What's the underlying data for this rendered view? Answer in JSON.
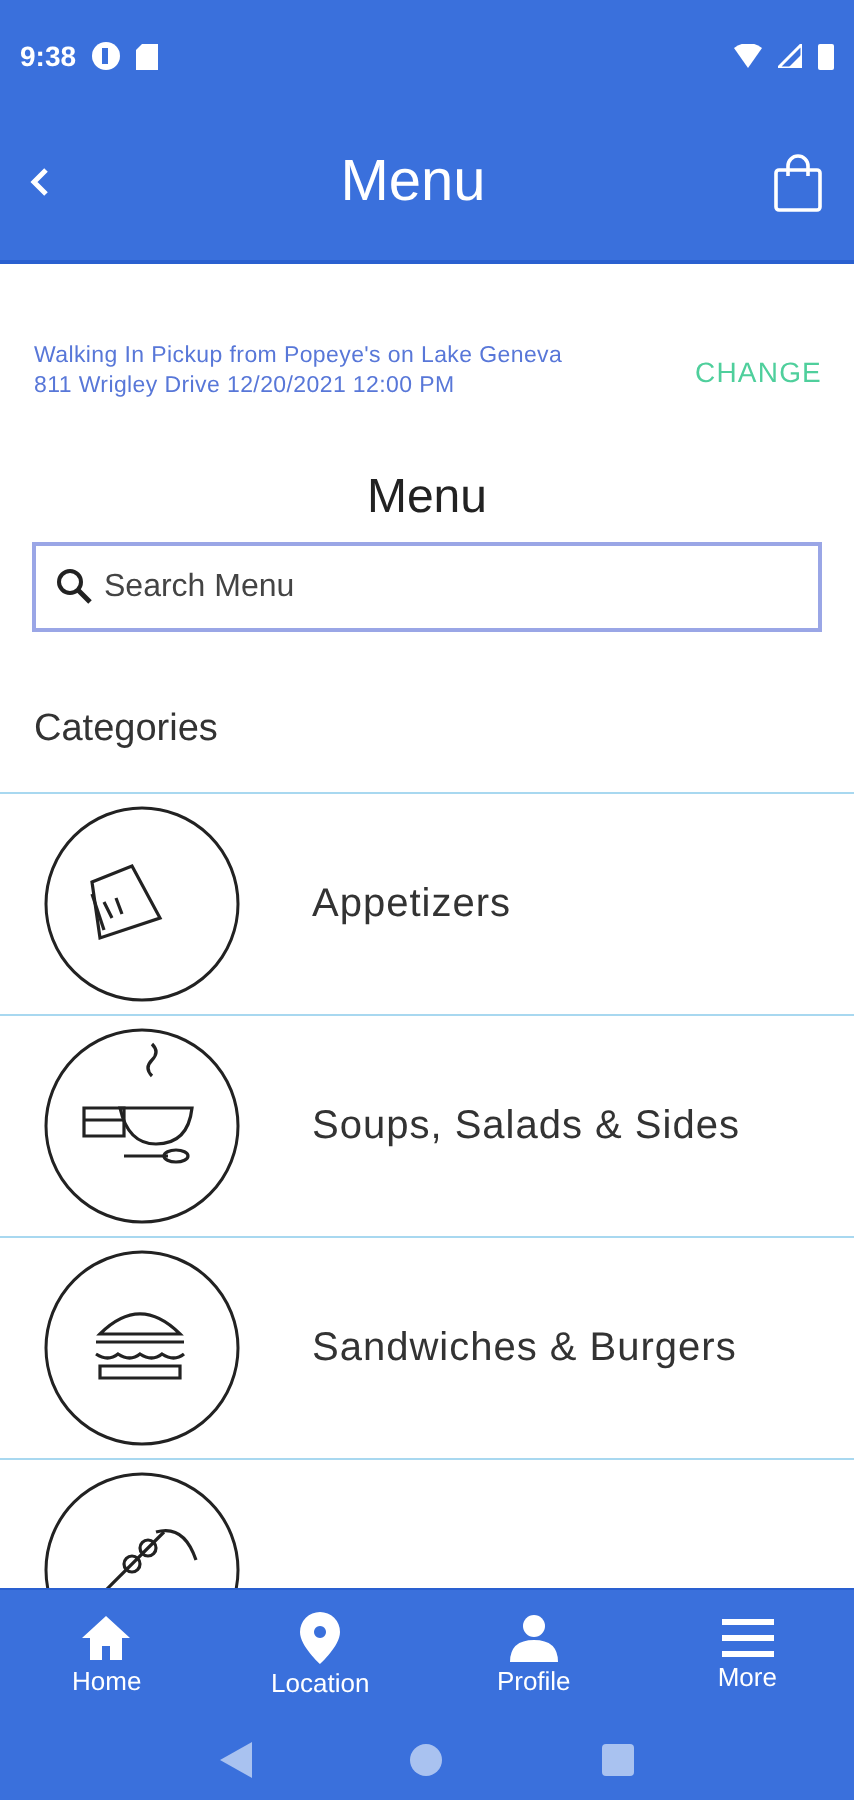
{
  "status_bar": {
    "time": "9:38"
  },
  "header": {
    "title": "Menu"
  },
  "order_info": {
    "line_1": "Walking In Pickup from Popeye's on Lake Geneva",
    "line_2": "811 Wrigley Drive 12/20/2021 12:00 PM",
    "action": "CHANGE"
  },
  "menu_heading": "Menu",
  "search": {
    "placeholder": "Search Menu"
  },
  "categories_heading": "Categories",
  "categories": [
    {
      "kind": "sandwich",
      "label": "Appetizers"
    },
    {
      "kind": "soup",
      "label": "Soups, Salads & Sides"
    },
    {
      "kind": "burger",
      "label": "Sandwiches & Burgers"
    },
    {
      "kind": "skewer"
    }
  ],
  "bottom_nav": [
    {
      "kind": "home",
      "label": "Home"
    },
    {
      "kind": "location",
      "label": "Location"
    },
    {
      "kind": "profile",
      "label": "Profile"
    },
    {
      "kind": "more",
      "label": "More"
    }
  ]
}
